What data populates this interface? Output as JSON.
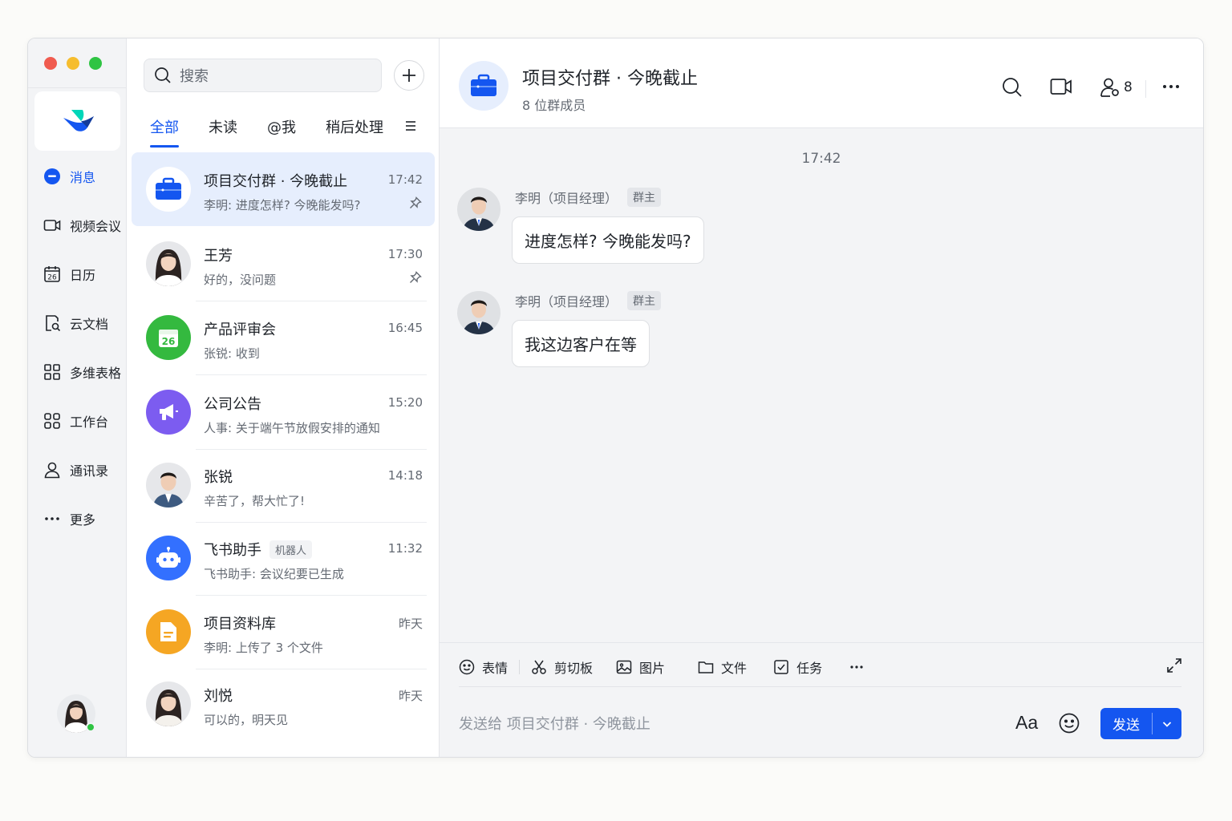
{
  "nav": {
    "items": [
      {
        "label": "消息",
        "icon": "message-icon"
      },
      {
        "label": "视频会议",
        "icon": "video-icon"
      },
      {
        "label": "日历",
        "icon": "calendar-icon",
        "icon_text": "26"
      },
      {
        "label": "云文档",
        "icon": "doc-search-icon"
      },
      {
        "label": "多维表格",
        "icon": "grid-icon"
      },
      {
        "label": "工作台",
        "icon": "apps-icon"
      },
      {
        "label": "通讯录",
        "icon": "contacts-icon"
      },
      {
        "label": "更多",
        "icon": "more-icon"
      }
    ]
  },
  "search": {
    "placeholder": "搜索"
  },
  "tabs": [
    "全部",
    "未读",
    "@我",
    "稍后处理"
  ],
  "conversations": [
    {
      "name": "项目交付群 · 今晚截止",
      "time": "17:42",
      "preview": "李明: 进度怎样? 今晚能发吗?",
      "pinned": true,
      "avatar": "briefcase-icon"
    },
    {
      "name": "王芳",
      "time": "17:30",
      "preview": "好的，没问题",
      "pinned": true,
      "avatar": "person-avatar"
    },
    {
      "name": "产品评审会",
      "time": "16:45",
      "preview": "张锐: 收到",
      "avatar": "calendar-icon",
      "avatar_text": "26"
    },
    {
      "name": "公司公告",
      "time": "15:20",
      "preview": "人事: 关于端午节放假安排的通知",
      "avatar": "megaphone-icon"
    },
    {
      "name": "张锐",
      "time": "14:18",
      "preview": "辛苦了，帮大忙了!",
      "avatar": "person-avatar"
    },
    {
      "name": "飞书助手",
      "badge": "机器人",
      "time": "11:32",
      "preview": "飞书助手: 会议纪要已生成",
      "avatar": "robot-icon"
    },
    {
      "name": "项目资料库",
      "time": "昨天",
      "preview": "李明: 上传了 3 个文件",
      "avatar": "folder-icon"
    },
    {
      "name": "刘悦",
      "time": "昨天",
      "preview": "可以的，明天见",
      "avatar": "person-avatar"
    }
  ],
  "chat": {
    "title": "项目交付群 · 今晚截止",
    "subtitle": "8 位群成员",
    "member_count": "8",
    "timestamp": "17:42",
    "messages": [
      {
        "sender": "李明（项目经理）",
        "badge": "群主",
        "text": "进度怎样? 今晚能发吗?"
      },
      {
        "sender": "李明（项目经理）",
        "badge": "群主",
        "text": "我这边客户在等"
      }
    ]
  },
  "composer": {
    "tools": [
      "表情",
      "剪切板",
      "图片",
      "文件",
      "任务"
    ],
    "placeholder": "发送给 项目交付群 · 今晚截止",
    "format_label": "Aa",
    "send_label": "发送"
  },
  "colors": {
    "accent": "#1456f0",
    "selected_bg": "#e6eefd",
    "green": "#34b93f",
    "purple": "#7c5cf0",
    "orange": "#f5a623"
  }
}
